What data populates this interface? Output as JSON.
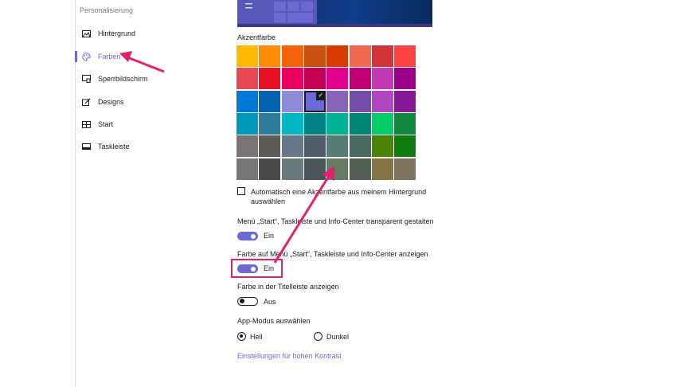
{
  "sidebar": {
    "heading": "Personalisierung",
    "items": [
      {
        "label": "Hintergrund",
        "icon": "image-icon"
      },
      {
        "label": "Farben",
        "icon": "palette-icon",
        "active": true
      },
      {
        "label": "Sperrbildschirm",
        "icon": "lockscreen-icon"
      },
      {
        "label": "Designs",
        "icon": "brush-icon"
      },
      {
        "label": "Start",
        "icon": "start-icon"
      },
      {
        "label": "Taskleiste",
        "icon": "taskbar-icon"
      }
    ]
  },
  "main": {
    "accent_label": "Akzentfarbe",
    "accent_colors": [
      [
        "#ffb900",
        "#ff8c00",
        "#f7630c",
        "#ca5010",
        "#da3b01",
        "#ef6950",
        "#d13438",
        "#ff4343"
      ],
      [
        "#e74856",
        "#e81123",
        "#ea005e",
        "#c30052",
        "#e3008c",
        "#bf0077",
        "#c239b3",
        "#9a0089"
      ],
      [
        "#0078d7",
        "#0063b1",
        "#8e8cd8",
        "#6b69d6",
        "#8764b8",
        "#744da9",
        "#b146c2",
        "#881798"
      ],
      [
        "#0099bc",
        "#2d7d9a",
        "#00b7c3",
        "#038387",
        "#00b294",
        "#018574",
        "#00cc6a",
        "#10893e"
      ],
      [
        "#7a7574",
        "#5d5a58",
        "#68768a",
        "#515c6b",
        "#567c73",
        "#486860",
        "#498205",
        "#107c10"
      ],
      [
        "#767676",
        "#4c4a48",
        "#69797e",
        "#4a5459",
        "#647c64",
        "#525e54",
        "#847545",
        "#7e735f"
      ]
    ],
    "selected_color": "#6b69d6",
    "auto_color_label": "Automatisch eine Akzentfarbe aus meinem Hintergrund auswählen",
    "transparency_label": "Menü „Start“, Taskleiste und Info-Center transparent gestalten",
    "transparency_state": "Ein",
    "color_on_start_label": "Farbe auf Menü „Start“, Taskleiste und Info-Center anzeigen",
    "color_on_start_state": "Ein",
    "titlebar_label": "Farbe in der Titelleiste anzeigen",
    "titlebar_state": "Aus",
    "app_mode_label": "App-Modus auswählen",
    "app_mode_options": [
      "Hell",
      "Dunkel"
    ],
    "app_mode_selected": "Hell",
    "contrast_link": "Einstellungen für hohen Kontrast"
  },
  "colors": {
    "accent": "#6b69d6",
    "annotation": "#e2216d"
  }
}
